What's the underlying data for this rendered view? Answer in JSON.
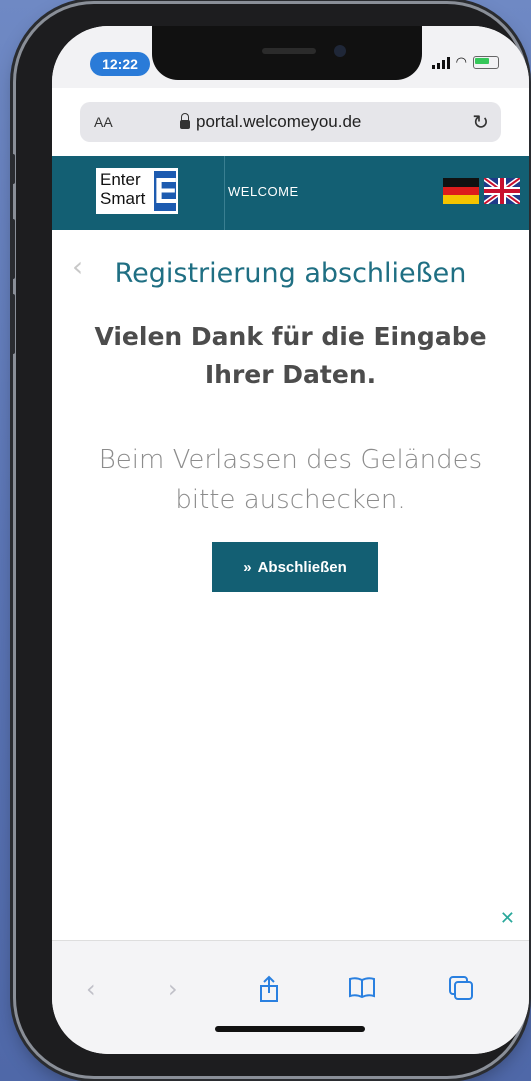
{
  "status_bar": {
    "time": "12:22"
  },
  "browser": {
    "text_size_label": "AA",
    "url": "portal.welcomeyou.de"
  },
  "site_header": {
    "logo_line1": "Enter",
    "logo_line2": "Smart",
    "logo_mark": "E",
    "nav_label": "WELCOME",
    "languages": [
      "de",
      "en"
    ]
  },
  "main": {
    "title": "Registrierung abschließen",
    "subtitle": "Vielen Dank für die Eingabe Ihrer Daten.",
    "note": "Beim Verlassen des Geländes bitte auschecken.",
    "finish_button": {
      "icon": "»",
      "label": "Abschließen"
    }
  },
  "toolbar": {
    "items": [
      "back-icon",
      "forward-icon",
      "share-icon",
      "bookmarks-icon",
      "tabs-icon"
    ]
  },
  "colors": {
    "brand": "#135f73",
    "title": "#1f6f83",
    "link": "#2a80e0"
  }
}
